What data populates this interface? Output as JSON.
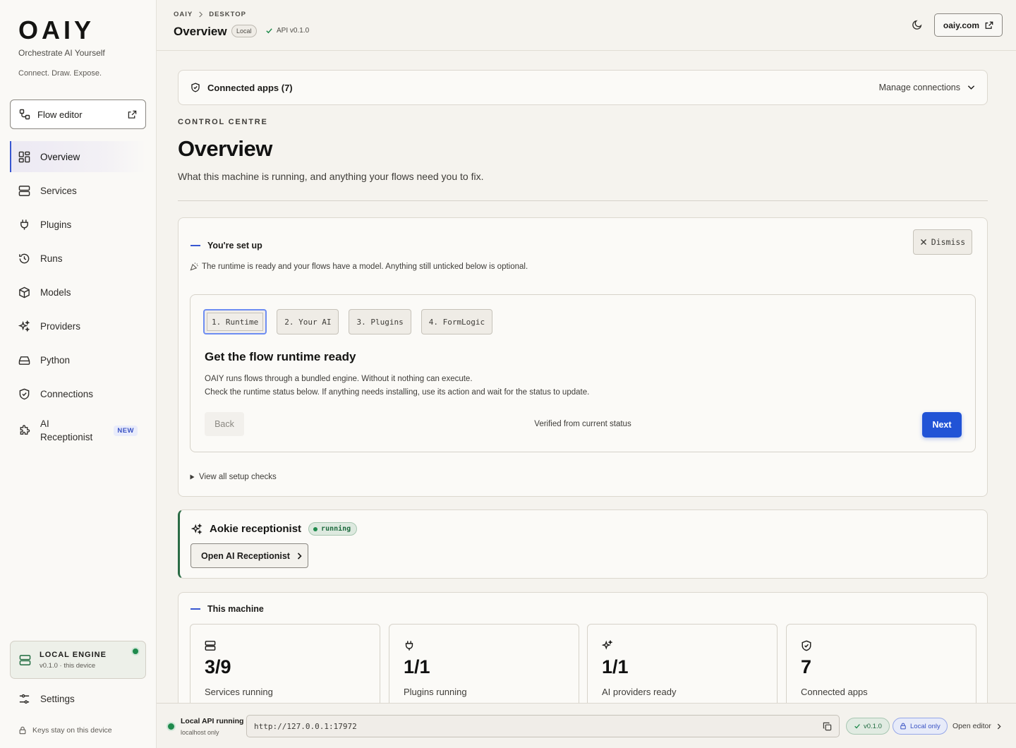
{
  "brand": {
    "logo": "OAIY",
    "tagline": "Orchestrate AI Yourself",
    "subtagline": "Connect. Draw. Expose."
  },
  "sidebar": {
    "flow_editor": "Flow editor",
    "items": [
      {
        "label": "Overview",
        "icon": "overview-grid-icon"
      },
      {
        "label": "Services",
        "icon": "server-icon"
      },
      {
        "label": "Plugins",
        "icon": "plug-icon"
      },
      {
        "label": "Runs",
        "icon": "history-icon"
      },
      {
        "label": "Models",
        "icon": "cube-icon"
      },
      {
        "label": "Providers",
        "icon": "sparkles-icon"
      },
      {
        "label": "Python",
        "icon": "drive-icon"
      },
      {
        "label": "Connections",
        "icon": "shield-icon"
      },
      {
        "label": "AI Receptionist",
        "icon": "puzzle-icon",
        "badge": "NEW"
      }
    ],
    "engine": {
      "title": "LOCAL ENGINE",
      "sub": "v0.1.0 · this device"
    },
    "settings": "Settings",
    "keys_note": "Keys stay on this device"
  },
  "header": {
    "crumb_root": "OAIY",
    "crumb_page": "DESKTOP",
    "title": "Overview",
    "local_pill": "Local",
    "api_version": "API v0.1.0",
    "site_button": "oaiy.com"
  },
  "connected": {
    "label": "Connected apps (7)",
    "manage": "Manage connections"
  },
  "page": {
    "eyebrow": "CONTROL CENTRE",
    "title": "Overview",
    "description": "What this machine is running, and anything your flows need you to fix."
  },
  "setup": {
    "title": "You're set up",
    "dismiss": "Dismiss",
    "note": "The runtime is ready and your flows have a model. Anything still unticked below is optional.",
    "steps": [
      "1. Runtime",
      "2. Your AI",
      "3. Plugins",
      "4. FormLogic"
    ],
    "active_step": 0,
    "step_title": "Get the flow runtime ready",
    "step_text_1": "OAIY runs flows through a bundled engine. Without it nothing can execute.",
    "step_text_2": "Check the runtime status below. If anything needs installing, use its action and wait for the status to update.",
    "back": "Back",
    "verified": "Verified from current status",
    "next": "Next",
    "view_all": "View all setup checks"
  },
  "receptionist": {
    "title": "Aokie receptionist",
    "status": "running",
    "open_button": "Open AI Receptionist"
  },
  "machine": {
    "title": "This machine",
    "stats": [
      {
        "value": "3/9",
        "label": "Services running",
        "icon": "server-icon"
      },
      {
        "value": "1/1",
        "label": "Plugins running",
        "icon": "plug-icon"
      },
      {
        "value": "1/1",
        "label": "AI providers ready",
        "icon": "sparkles-icon"
      },
      {
        "value": "7",
        "label": "Connected apps",
        "icon": "shield-icon"
      }
    ]
  },
  "statusbar": {
    "title": "Local API running",
    "sub": "localhost only",
    "url": "http://127.0.0.1:17972",
    "version": "v0.1.0",
    "local_only": "Local only",
    "open_editor": "Open editor"
  },
  "colors": {
    "accent": "#2153d6",
    "running": "#1f8a4c",
    "background": "#f5f3ee"
  }
}
